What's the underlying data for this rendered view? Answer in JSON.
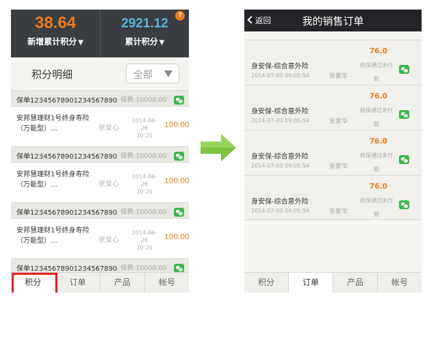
{
  "left": {
    "stats": [
      {
        "value": "38.64",
        "label": "新增累计积分"
      },
      {
        "value": "2921.12",
        "label": "累计积分"
      }
    ],
    "badge": "?",
    "section_title": "积分明细",
    "filter": {
      "selected": "全部"
    },
    "rows": [
      {
        "type": "policy",
        "number": "保单12345678901234567890",
        "fee": "保费:10000.00"
      },
      {
        "type": "product",
        "name_line1": "安邦慧理财1号终身寿险",
        "name_line2": "（万能型）...",
        "agent": "张爱心",
        "date": "2014-06-26",
        "time": "10:20",
        "points": "100.00"
      },
      {
        "type": "policy",
        "number": "保单12345678901234567890",
        "fee": "保费:10000.00"
      },
      {
        "type": "product",
        "name_line1": "安邦慧理财1号终身寿险",
        "name_line2": "（万能型）...",
        "agent": "张爱心",
        "date": "2014-06-26",
        "time": "10:20",
        "points": "100.00"
      },
      {
        "type": "policy",
        "number": "保单12345678901234567890",
        "fee": "保费:10000.00"
      },
      {
        "type": "product",
        "name_line1": "安邦慧理财1号终身寿险",
        "name_line2": "（万能型）...",
        "agent": "张爱心",
        "date": "2014-06-26",
        "time": "10:20",
        "points": "100.00"
      },
      {
        "type": "policy",
        "number": "保单12345678901234567890",
        "fee": "保费:10000.00"
      }
    ],
    "tabs": [
      "积分",
      "订单",
      "产品",
      "帐号"
    ]
  },
  "right": {
    "back_label": "返回",
    "title": "我的销售订单",
    "orders": [
      {
        "name": "身安保-综合意外险",
        "datetime": "2014-07-03 09:05:54",
        "agent": "张爱华",
        "points": "76.0",
        "status_line1": "核保通过未付",
        "status_line2": "款"
      },
      {
        "name": "身安保-综合意外险",
        "datetime": "2014-07-03 09:05:54",
        "agent": "张爱华",
        "points": "76.0",
        "status_line1": "核保通过未付",
        "status_line2": "款"
      },
      {
        "name": "身安保-综合意外险",
        "datetime": "2014-07-03 09:05:54",
        "agent": "张爱华",
        "points": "76.0",
        "status_line1": "核保通过未付",
        "status_line2": "款"
      },
      {
        "name": "身安保-综合意外险",
        "datetime": "2014-07-03 09:05:54",
        "agent": "张爱华",
        "points": "76.0",
        "status_line1": "核保通过未付",
        "status_line2": "款"
      }
    ],
    "tabs": [
      "积分",
      "订单",
      "产品",
      "帐号"
    ]
  },
  "colors": {
    "accent": "#f07a1c",
    "blue": "#5db7d8",
    "header_bg": "#3a3d42",
    "wechat": "#3eb54a",
    "highlight": "#e3201d",
    "arrow": "#7dc242"
  },
  "icons": {
    "wechat": "wechat-icon",
    "arrow": "right-arrow-icon",
    "back": "chevron-left-icon",
    "dropdown": "caret-down-icon",
    "help": "question-badge-icon"
  }
}
